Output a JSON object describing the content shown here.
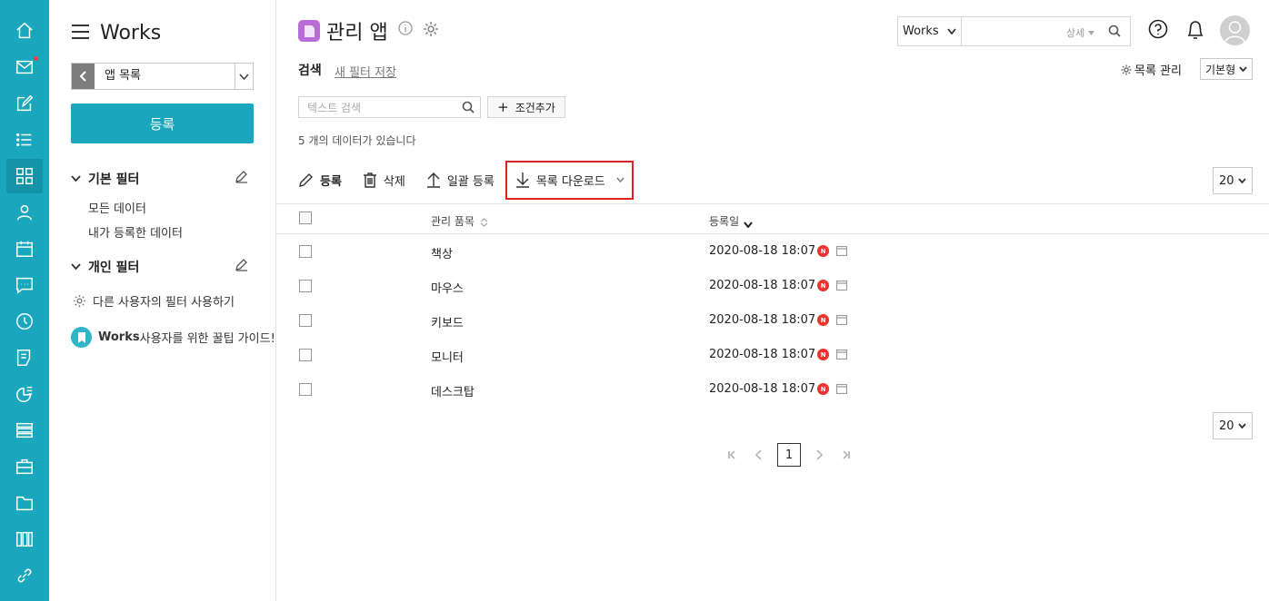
{
  "sidebar": {
    "app_title": "Works",
    "app_select_value": "앱 목록",
    "register_label": "등록",
    "basic_filter_title": "기본 필터",
    "basic_filters": [
      "모든 데이터",
      "내가 등록한 데이터"
    ],
    "personal_filter_title": "개인 필터",
    "other_filter_label": "다른 사용자의 필터 사용하기",
    "guide_brand": "Works",
    "guide_text": " 사용자를 위한 꿀팁 가이드!"
  },
  "header": {
    "page_title": "관리 앱",
    "search_scope": "Works",
    "search_detail": "상세"
  },
  "search": {
    "label": "검색",
    "save_filter": "새 필터 저장",
    "list_manage": "목록 관리",
    "view_type": "기본형",
    "text_placeholder": "텍스트 검색",
    "add_condition": "조건추가",
    "data_count": "5 개의 데이터가 있습니다"
  },
  "toolbar": {
    "register": "등록",
    "delete": "삭제",
    "bulk_register": "일괄 등록",
    "download": "목록 다운로드",
    "page_size": "20"
  },
  "table": {
    "headers": {
      "item": "관리 품목",
      "date": "등록일"
    },
    "rows": [
      {
        "item": "책상",
        "date": "2020-08-18 18:07",
        "badge": "N"
      },
      {
        "item": "마우스",
        "date": "2020-08-18 18:07",
        "badge": "N"
      },
      {
        "item": "키보드",
        "date": "2020-08-18 18:07",
        "badge": "N"
      },
      {
        "item": "모니터",
        "date": "2020-08-18 18:07",
        "badge": "N"
      },
      {
        "item": "데스크탑",
        "date": "2020-08-18 18:07",
        "badge": "N"
      }
    ]
  },
  "pagination": {
    "page_size": "20",
    "current_page": "1"
  },
  "colors": {
    "accent": "#1aa7bd",
    "app_icon": "#b96bd6",
    "highlight_border": "#e0201f",
    "new_badge": "#e8362f"
  }
}
